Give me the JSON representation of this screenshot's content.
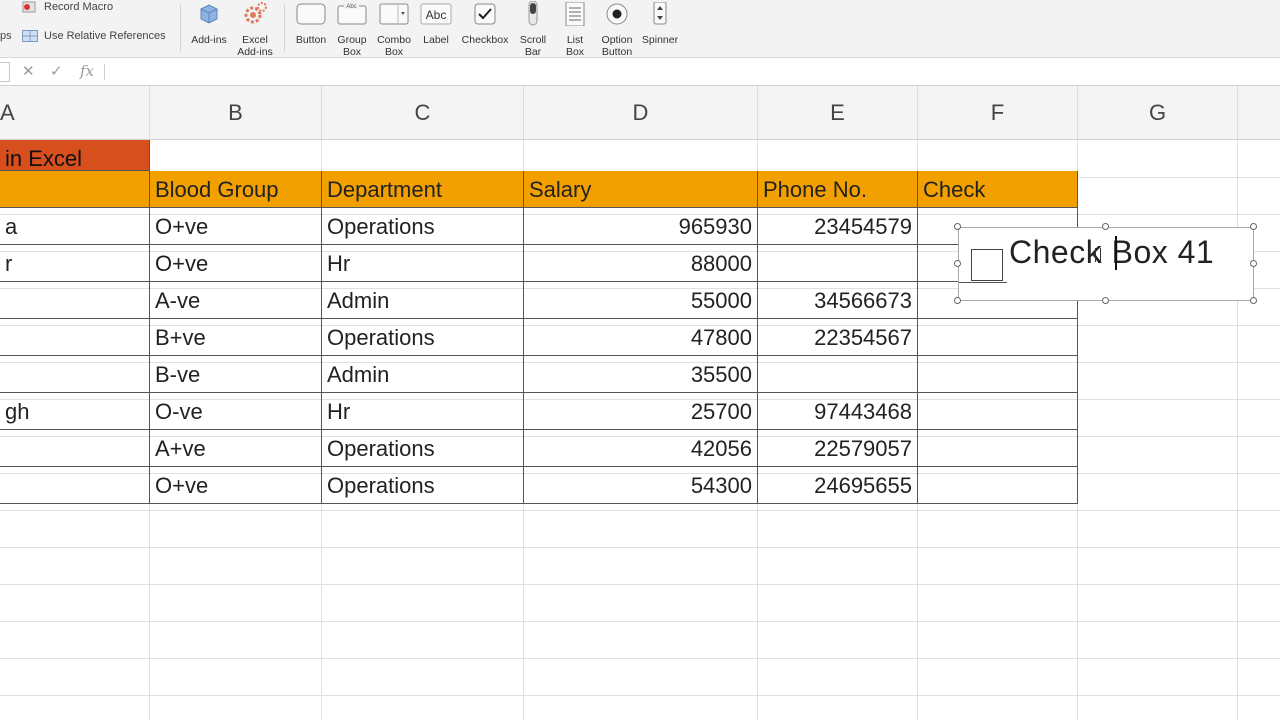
{
  "ribbon": {
    "record_macro": "Record Macro",
    "use_relative_refs": "Use Relative References",
    "cut_label": "ps",
    "addins": "Add-ins",
    "excel_addins_1": "Excel",
    "excel_addins_2": "Add-ins",
    "controls": {
      "button": "Button",
      "group_box_1": "Group",
      "group_box_2": "Box",
      "combo_box_1": "Combo",
      "combo_box_2": "Box",
      "label": "Label",
      "label_icon_text": "Abc",
      "group_icon_text": "Abc",
      "checkbox": "Checkbox",
      "scroll_bar_1": "Scroll",
      "scroll_bar_2": "Bar",
      "list_box_1": "List",
      "list_box_2": "Box",
      "option_button_1": "Option",
      "option_button_2": "Button",
      "spinner": "Spinner"
    }
  },
  "formula_bar": {
    "cancel": "✕",
    "enter": "✓",
    "fx": "fx",
    "value": ""
  },
  "columns": [
    "A",
    "B",
    "C",
    "D",
    "E",
    "F",
    "G"
  ],
  "sheet": {
    "title": "in Excel",
    "headers": {
      "blood_group": "Blood Group",
      "department": "Department",
      "salary": "Salary",
      "phone": "Phone No.",
      "check": "Check"
    },
    "rows": [
      {
        "a": "a",
        "blood": "O+ve",
        "dept": "Operations",
        "salary": "965930",
        "phone": "23454579"
      },
      {
        "a": "r",
        "blood": "O+ve",
        "dept": "Hr",
        "salary": "88000",
        "phone": ""
      },
      {
        "a": "",
        "blood": "A-ve",
        "dept": "Admin",
        "salary": "55000",
        "phone": "34566673"
      },
      {
        "a": "",
        "blood": "B+ve",
        "dept": "Operations",
        "salary": "47800",
        "phone": "22354567"
      },
      {
        "a": "",
        "blood": "B-ve",
        "dept": "Admin",
        "salary": "35500",
        "phone": ""
      },
      {
        "a": "gh",
        "blood": "O-ve",
        "dept": "Hr",
        "salary": "25700",
        "phone": "97443468"
      },
      {
        "a": "",
        "blood": "A+ve",
        "dept": "Operations",
        "salary": "42056",
        "phone": "22579057"
      },
      {
        "a": "",
        "blood": "O+ve",
        "dept": "Operations",
        "salary": "54300",
        "phone": "24695655"
      }
    ]
  },
  "checkbox_control": {
    "label": "Check Box 41",
    "checked": false
  },
  "colors": {
    "title_fill": "#d84f1e",
    "header_fill": "#f1a000",
    "sheet_bg": "#ffffff"
  }
}
